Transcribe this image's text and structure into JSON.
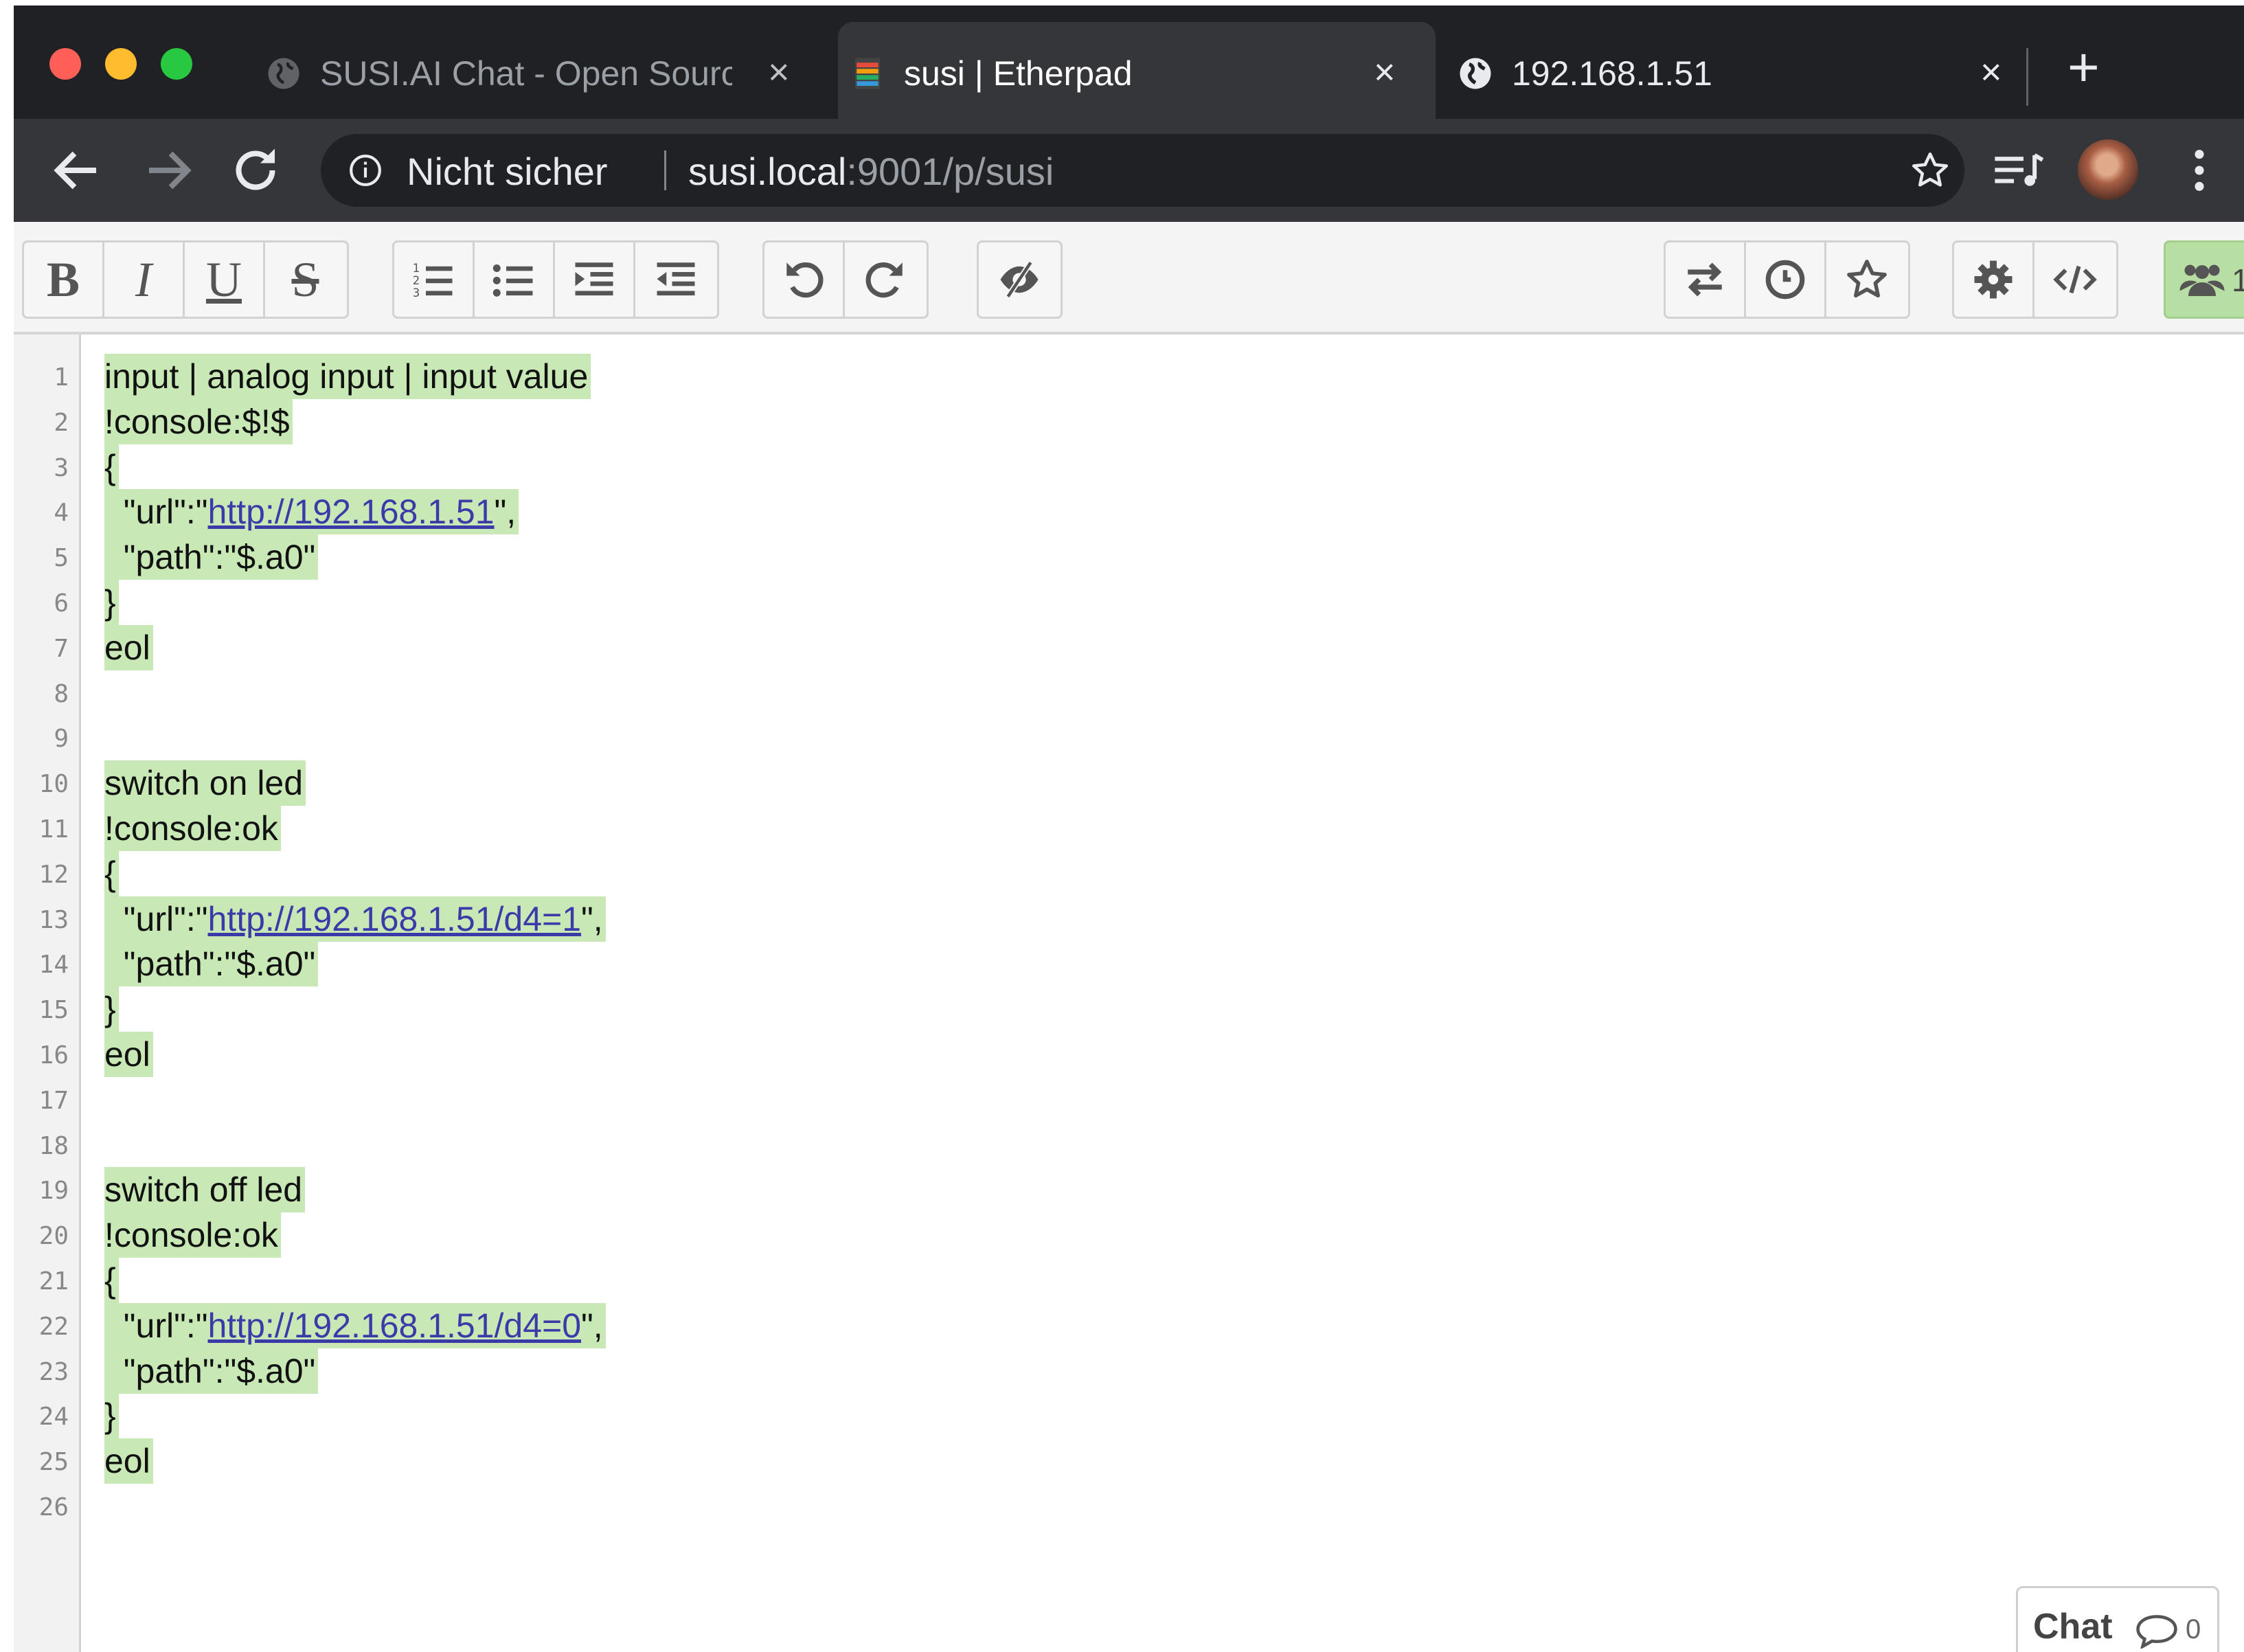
{
  "browser": {
    "tabs": [
      {
        "title": "SUSI.AI Chat - Open Source",
        "favicon": "globe-icon",
        "active": false
      },
      {
        "title": "susi | Etherpad",
        "favicon": "etherpad-icon",
        "active": true
      },
      {
        "title": "192.168.1.51",
        "favicon": "globe-icon",
        "active": false
      }
    ],
    "new_tab_label": "+",
    "close_glyph": "×",
    "security_label": "Nicht sicher",
    "url_host": "susi.local",
    "url_rest": ":9001/p/susi"
  },
  "toolbar": {
    "format_buttons": [
      "B",
      "I",
      "U",
      "S"
    ],
    "icons": [
      "ordered-list-icon",
      "unordered-list-icon",
      "indent-icon",
      "outdent-icon",
      "undo-icon",
      "redo-icon",
      "clear-authorship-icon",
      "import-export-icon",
      "timeslider-icon",
      "save-revision-icon",
      "settings-icon",
      "embed-icon",
      "users-icon"
    ],
    "users_count": "1"
  },
  "editor": {
    "lines": [
      {
        "n": "1",
        "text": "input | analog input | input value"
      },
      {
        "n": "2",
        "text": "!console:$!$"
      },
      {
        "n": "3",
        "text": "{"
      },
      {
        "n": "4",
        "pre": "  \"url\":\"",
        "link": "http://192.168.1.51",
        "post": "\","
      },
      {
        "n": "5",
        "text": "  \"path\":\"$.a0\""
      },
      {
        "n": "6",
        "text": "}"
      },
      {
        "n": "7",
        "text": "eol"
      },
      {
        "n": "8",
        "text": ""
      },
      {
        "n": "9",
        "text": ""
      },
      {
        "n": "10",
        "text": "switch on led"
      },
      {
        "n": "11",
        "text": "!console:ok"
      },
      {
        "n": "12",
        "text": "{"
      },
      {
        "n": "13",
        "pre": "  \"url\":\"",
        "link": "http://192.168.1.51/d4=1",
        "post": "\","
      },
      {
        "n": "14",
        "text": "  \"path\":\"$.a0\""
      },
      {
        "n": "15",
        "text": "}"
      },
      {
        "n": "16",
        "text": "eol"
      },
      {
        "n": "17",
        "text": ""
      },
      {
        "n": "18",
        "text": ""
      },
      {
        "n": "19",
        "text": "switch off led"
      },
      {
        "n": "20",
        "text": "!console:ok"
      },
      {
        "n": "21",
        "text": "{"
      },
      {
        "n": "22",
        "pre": "  \"url\":\"",
        "link": "http://192.168.1.51/d4=0",
        "post": "\","
      },
      {
        "n": "23",
        "text": "  \"path\":\"$.a0\""
      },
      {
        "n": "24",
        "text": "}"
      },
      {
        "n": "25",
        "text": "eol"
      },
      {
        "n": "26",
        "text": ""
      }
    ]
  },
  "chat": {
    "label": "Chat",
    "count": "0"
  },
  "colors": {
    "author_highlight": "#c8e9b6",
    "link": "#3b3aa8",
    "chrome_dark": "#202124"
  }
}
